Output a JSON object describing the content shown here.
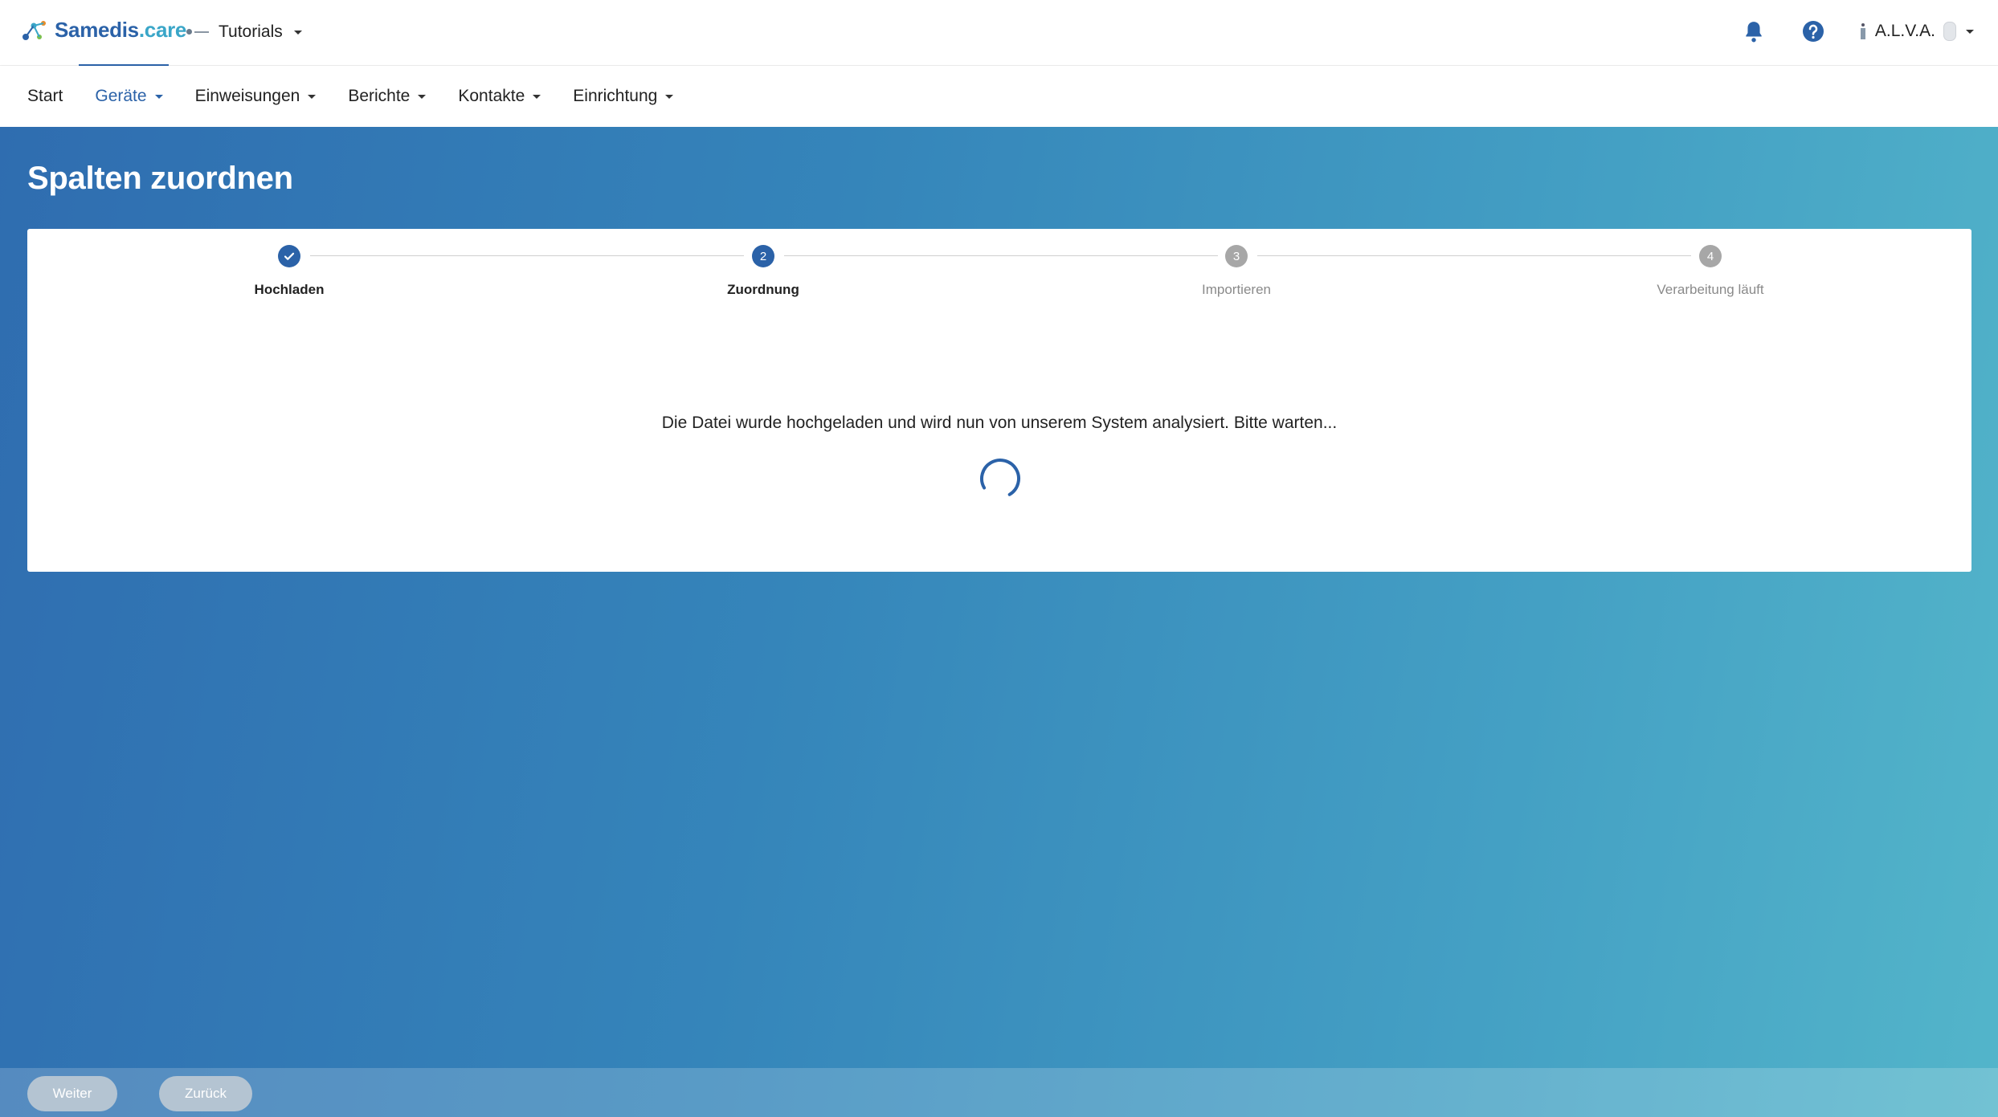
{
  "header": {
    "brand_name": "Samedis",
    "brand_tld": ".care",
    "tenant_label": "Tutorials",
    "user_name": "A.L.V.A."
  },
  "nav": {
    "items": [
      {
        "label": "Start",
        "has_dropdown": false,
        "active": false
      },
      {
        "label": "Geräte",
        "has_dropdown": true,
        "active": true
      },
      {
        "label": "Einweisungen",
        "has_dropdown": true,
        "active": false
      },
      {
        "label": "Berichte",
        "has_dropdown": true,
        "active": false
      },
      {
        "label": "Kontakte",
        "has_dropdown": true,
        "active": false
      },
      {
        "label": "Einrichtung",
        "has_dropdown": true,
        "active": false
      }
    ]
  },
  "page": {
    "title": "Spalten zuordnen"
  },
  "stepper": {
    "steps": [
      {
        "number": "1",
        "label": "Hochladen",
        "state": "done"
      },
      {
        "number": "2",
        "label": "Zuordnung",
        "state": "current"
      },
      {
        "number": "3",
        "label": "Importieren",
        "state": "pending"
      },
      {
        "number": "4",
        "label": "Verarbeitung läuft",
        "state": "pending"
      }
    ]
  },
  "status": {
    "message": "Die Datei wurde hochgeladen und wird nun von unserem System analysiert. Bitte warten..."
  },
  "footer": {
    "next_label": "Weiter",
    "back_label": "Zurück"
  },
  "colors": {
    "primary": "#2b62a8",
    "accent": "#3aa6c8",
    "pending": "#a7a7a7"
  }
}
